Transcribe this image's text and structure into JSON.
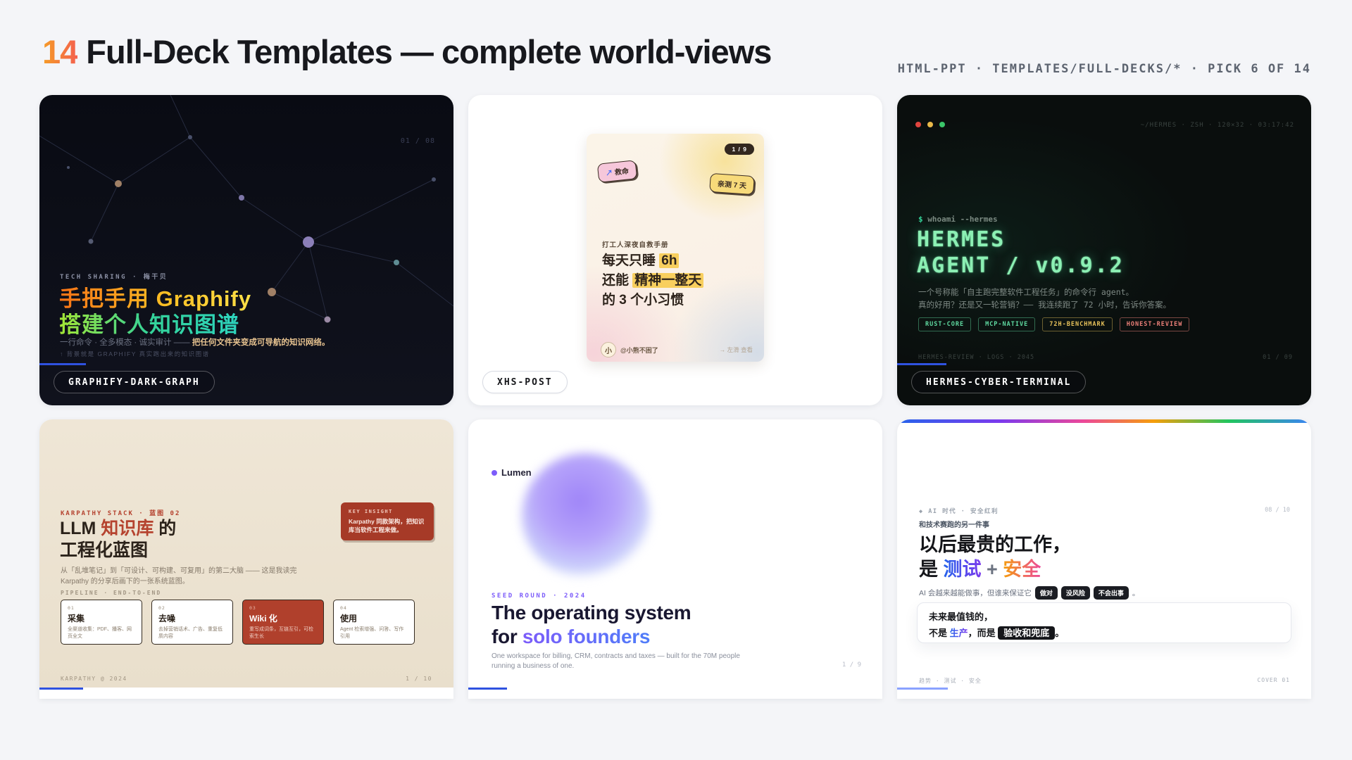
{
  "page": {
    "header": {
      "number": "14",
      "title": "Full-Deck Templates — complete world-views"
    },
    "meta": "HTML-PPT · TEMPLATES/FULL-DECKS/* · PICK 6 OF 14"
  },
  "colors": {
    "progress_blue": "#2f52e0",
    "accent_orange": "#f59d27",
    "accent_red": "#f4604d",
    "terminal_green": "#8cf0b4"
  },
  "cards": {
    "graphify": {
      "badge": "GRAPHIFY-DARK-GRAPH",
      "page_indicator": "01 / 08",
      "eyebrow": "TECH SHARING · 梅干贝",
      "title_line1": "手把手用 Graphify",
      "title_line2": "搭建个人知识图谱",
      "subtitle_dim": "一行命令 · 全多模态 · 诚实审计 —— ",
      "subtitle_highlight": "把任何文件夹变成可导航的知识网络。",
      "note": "↑ 背景就是 GRAPHIFY 真实跑出来的知识图谱"
    },
    "xhs": {
      "badge": "XHS-POST",
      "pager": "1 / 9",
      "sticker_pink_arrow": "↗",
      "sticker_pink": "救命",
      "sticker_yellow": "亲测 7 天",
      "kicker": "打工人深夜自救手册",
      "title_l1_pre": "每天只睡 ",
      "title_l1_mark": "6h",
      "title_l2_pre": "还能 ",
      "title_l2_mark": "精神一整天",
      "title_l3": "的 3 个小习惯",
      "avatar_char": "小",
      "handle": "@小熊不困了",
      "swipe_hint": "→ 左滑 查看"
    },
    "hermes": {
      "badge": "HERMES-CYBER-TERMINAL",
      "chrome": "~/HERMES · ZSH · 120×32 · 03:17:42",
      "prompt_symbol": "$",
      "prompt_cmd": " whoami --hermes",
      "big1": "HERMES",
      "big2": "AGENT / v0.9.2",
      "desc1": "一个号称能「自主跑完整软件工程任务」的命令行 agent。",
      "desc2": "真的好用？还是又一轮营销？—— 我连续跑了 72 小时，告诉你答案。",
      "tags": [
        {
          "label": "RUST-CORE"
        },
        {
          "label": "MCP-NATIVE"
        },
        {
          "label": "72H-BENCHMARK"
        },
        {
          "label": "HONEST-REVIEW"
        }
      ],
      "footer_left": "HERMES-REVIEW · LOGS · 2045",
      "footer_right": "01 / 09"
    },
    "karpathy": {
      "eyebrow": "KARPATHY STACK · 蓝图 02",
      "title_1a": "LLM ",
      "title_1b": "知识库",
      "title_1c": " 的",
      "title_2": "工程化蓝图",
      "callout_label": "KEY INSIGHT",
      "callout_text": "Karpathy 同款架构，把知识库当软件工程来做。",
      "para": "从「乱堆笔记」到「可设计、可构建、可复用」的第二大脑 —— 这是我读完 Karpathy 的分享后画下的一张系统蓝图。",
      "pipeline_label": "PIPELINE · END-TO-END",
      "steps": [
        {
          "num": "01",
          "title": "采集",
          "desc": "全渠道收集：PDF、播客、网页全文"
        },
        {
          "num": "02",
          "title": "去噪",
          "desc": "去掉营销话术、广告、重复低质内容"
        },
        {
          "num": "03",
          "title": "Wiki 化",
          "desc": "重写成词条，互链互引，可检索生长"
        },
        {
          "num": "04",
          "title": "使用",
          "desc": "Agent 检索增强、问答、写作引用"
        }
      ],
      "footer_left": "KARPATHY @ 2024",
      "footer_right": "1 / 10"
    },
    "lumen": {
      "logo": "Lumen",
      "eyebrow": "SEED ROUND · 2024",
      "title_1": "The operating system",
      "title_2_pre": "for ",
      "title_2_grad": "solo founders",
      "para_1": "One workspace for billing, CRM, contracts and taxes — built for the 70M people",
      "para_2": "running a business of one.",
      "pager": "1 / 9"
    },
    "safety": {
      "eyebrow": "◆ AI 时代 · 安全红利",
      "pager": "08 / 10",
      "kicker": "和技术赛跑的另一件事",
      "title_1": "以后最贵的工作，",
      "title_2_pre": "是 ",
      "title_2_g1": "测试",
      "title_2_plus": " + ",
      "title_2_g2": "安全",
      "line_pre": "AI 会越来越能做事，但谁来保证它",
      "pills": [
        "做对",
        "没风险",
        "不会出事"
      ],
      "line_suffix": "。",
      "box_line1": "未来最值钱的，",
      "box_l2a": "不是 ",
      "box_l2b": "生产",
      "box_l2c": "，而是 ",
      "box_pill": "验收和兜底",
      "box_l2d": "。",
      "footer_left": "趋势 · 测试 · 安全",
      "footer_right": "COVER 01"
    }
  }
}
